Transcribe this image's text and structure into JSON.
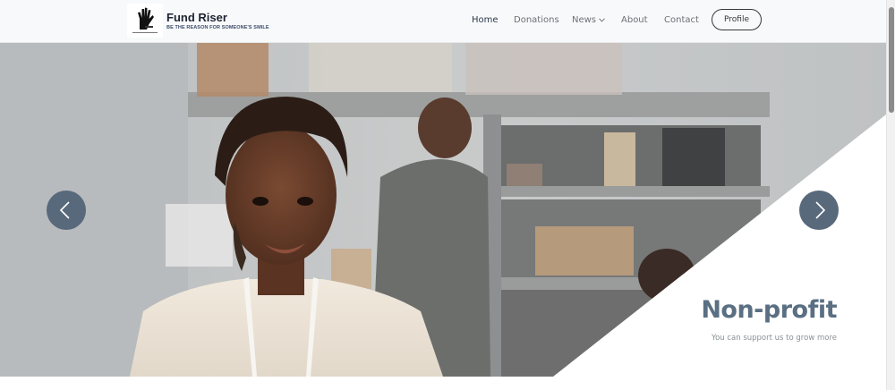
{
  "header": {
    "brand_title": "Fund Riser",
    "brand_tagline": "BE THE REASON FOR SOMEONE'S SMILE",
    "nav": [
      {
        "label": "Home",
        "active": true
      },
      {
        "label": "Donations",
        "active": false
      },
      {
        "label": "News",
        "active": false,
        "has_dropdown": true
      },
      {
        "label": "About",
        "active": false
      },
      {
        "label": "Contact",
        "active": false
      }
    ],
    "profile_label": "Profile"
  },
  "hero": {
    "slide_title": "Non-profit",
    "slide_text": "You can support us to grow more",
    "prev_icon": "chevron-left-icon",
    "next_icon": "chevron-right-icon"
  },
  "colors": {
    "accent": "#5a6f82",
    "button_bg": "#58697c",
    "header_bg": "#f8f9fa"
  }
}
